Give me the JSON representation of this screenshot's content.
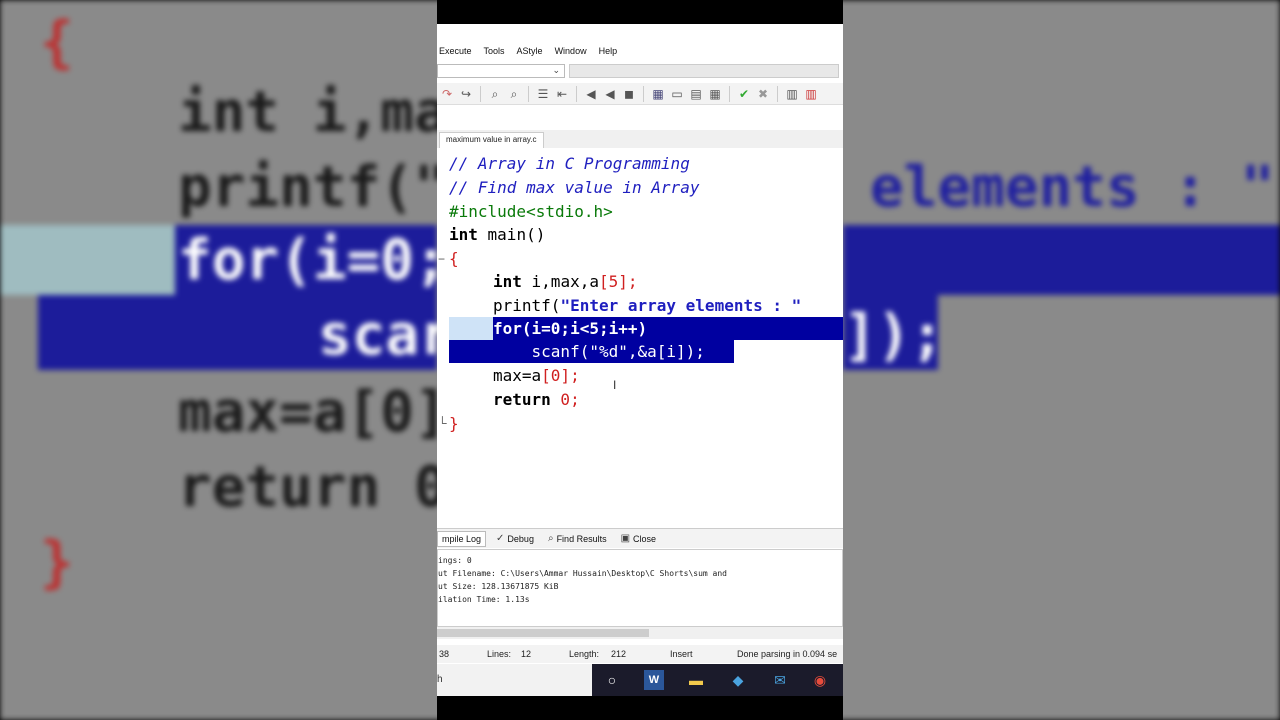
{
  "menu": {
    "items": [
      "Execute",
      "Tools",
      "AStyle",
      "Window",
      "Help"
    ]
  },
  "editor_tab": {
    "filename": "maximum value in array.c"
  },
  "code": {
    "line1": "// Array in C Programming",
    "line2": "// Find max value in Array",
    "line3": "#include<stdio.h>",
    "line4_kw": "int",
    "line4_rest": " main()",
    "line5": "{",
    "line6_kw": "int",
    "line6_rest": " i,max,a",
    "line6_idx": "[5]",
    "line6_end": ";",
    "line7_fn": "printf(",
    "line7_str": "\"Enter array elements : \"",
    "line8": "for(i=0;i<5;i++)",
    "line9": "    scanf(\"%d\",&a[i]);",
    "line10_a": "max=a",
    "line10_b": "[0]",
    "line10_c": ";",
    "line11_kw": "return",
    "line11_num": " 0",
    "line11_end": ";",
    "line12": "}"
  },
  "background": {
    "brace_open": "{",
    "int_line": "int i,ma",
    "printf_line": "printf(\"",
    "for_line": "for(i=0;",
    "scanf_line": "scar",
    "max_line": "max=a[0]",
    "return_line": "return 0",
    "brace_close": "}",
    "elements_text": "elements : \"",
    "tail_text": "]);"
  },
  "bottom_tabs": {
    "compile_log": "mpile Log",
    "debug": "Debug",
    "find_results": "Find Results",
    "close": "Close"
  },
  "log": {
    "line1": "ings: 0",
    "line2": "ut Filename: C:\\Users\\Ammar Hussain\\Desktop\\C Shorts\\sum and",
    "line3": "ut Size: 128.13671875 KiB",
    "line4": "ilation Time: 1.13s"
  },
  "status": {
    "col": "38",
    "lines_label": "Lines:",
    "lines_value": "12",
    "length_label": "Length:",
    "length_value": "212",
    "mode": "Insert",
    "parse": "Done parsing in 0.094 se"
  },
  "taskbar": {
    "search_text": "h"
  }
}
